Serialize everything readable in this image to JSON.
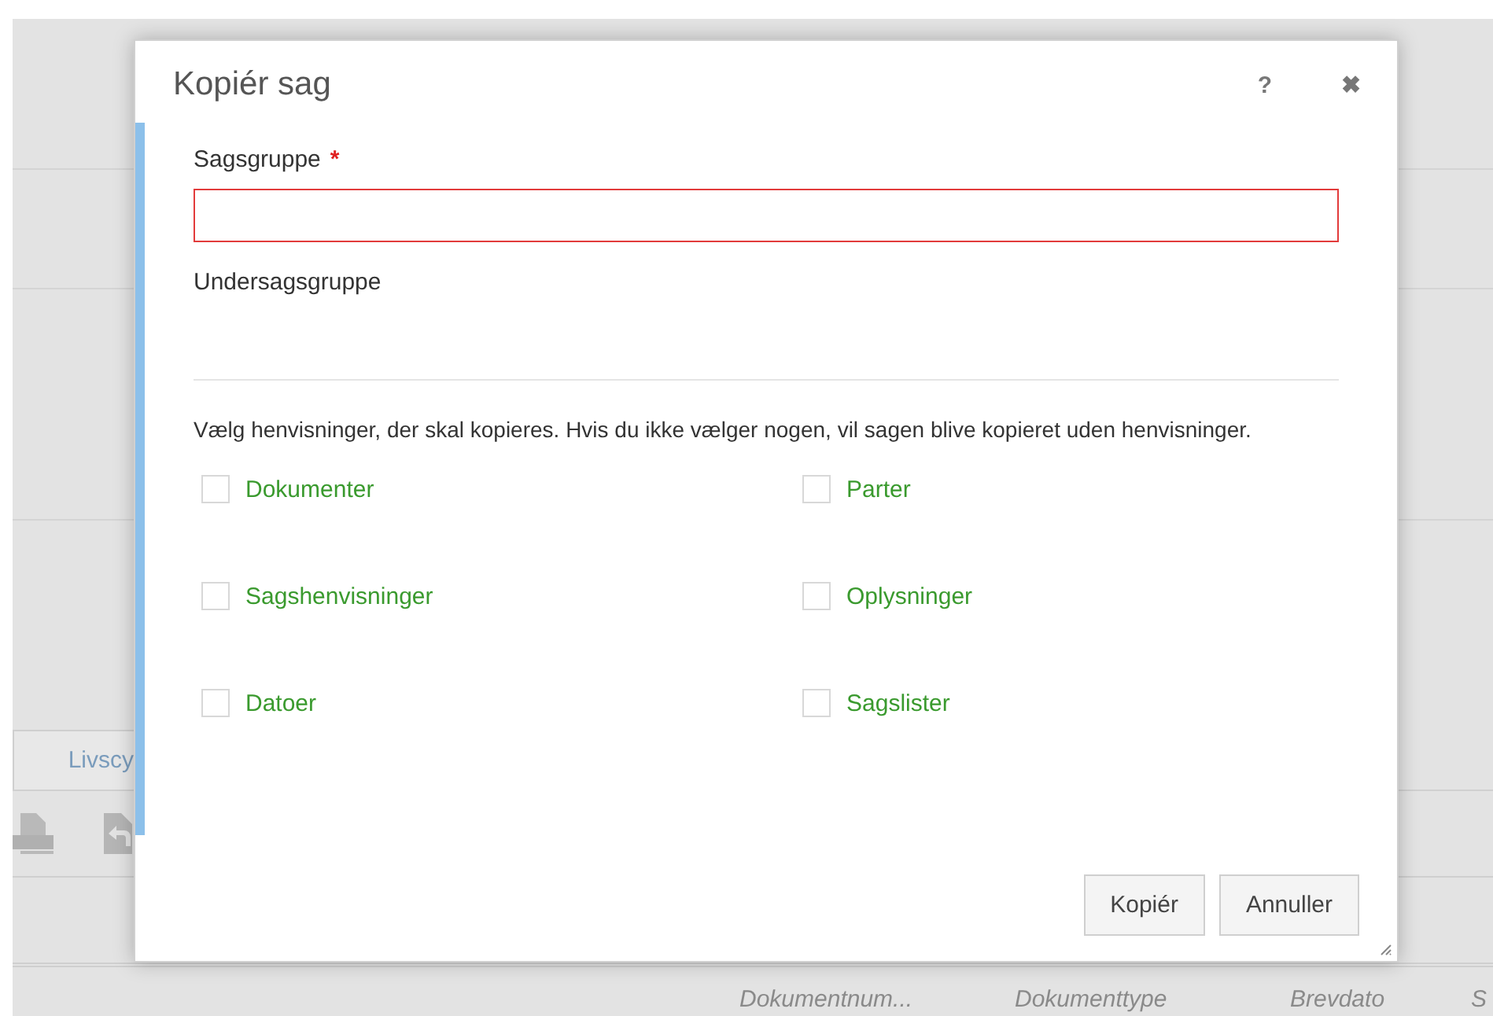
{
  "background": {
    "tab": "Livscy",
    "columns": [
      "Dokumentnum...",
      "Dokumenttype",
      "Brevdato",
      "S"
    ]
  },
  "dialog": {
    "title": "Kopiér sag",
    "help": "?",
    "close": "✖",
    "fields": [
      {
        "kind": "input",
        "label": "Sagsgruppe",
        "required_mark": "*",
        "invalid": true
      },
      {
        "kind": "label",
        "label": "Undersagsgruppe"
      }
    ],
    "instructions": "Vælg henvisninger, der skal kopieres. Hvis du ikke vælger nogen, vil sagen blive kopieret uden henvisninger.",
    "options": [
      {
        "label": "Dokumenter",
        "checked": false
      },
      {
        "label": "Parter",
        "checked": false
      },
      {
        "label": "Sagshenvisninger",
        "checked": false
      },
      {
        "label": "Oplysninger",
        "checked": false
      },
      {
        "label": "Datoer",
        "checked": false
      },
      {
        "label": "Sagslister",
        "checked": false
      }
    ],
    "buttons": [
      "Kopiér",
      "Annuller"
    ]
  }
}
